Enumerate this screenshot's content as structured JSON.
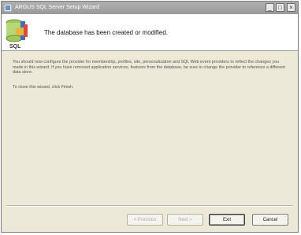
{
  "window": {
    "title": "ARGUS SQL Server Setup Wizard",
    "controls": {
      "minimize": "_",
      "maximize": "□",
      "close": "×"
    }
  },
  "header": {
    "title": "The database has been created or modified.",
    "logo_caption": "SQL"
  },
  "body": {
    "description": "You should now configure the provider for membership, profiles, site, personalization and SQL Web event providers to reflect the changes you made in this wizard. If you have removed application services, features from the database, be sure to change the provider to reference a different data store.",
    "hint": "To close this wizard, click Finish."
  },
  "buttons": {
    "back": "< Previous",
    "next": "Next >",
    "finish": "Exit",
    "cancel": "Cancel"
  },
  "icons": {
    "window_icon": "wizard-icon",
    "logo": "sql-database-icon"
  },
  "colors": {
    "titlebar": "#9a9a9a",
    "dialog_bg": "#ece9d8",
    "header_bg": "#ffffff"
  }
}
